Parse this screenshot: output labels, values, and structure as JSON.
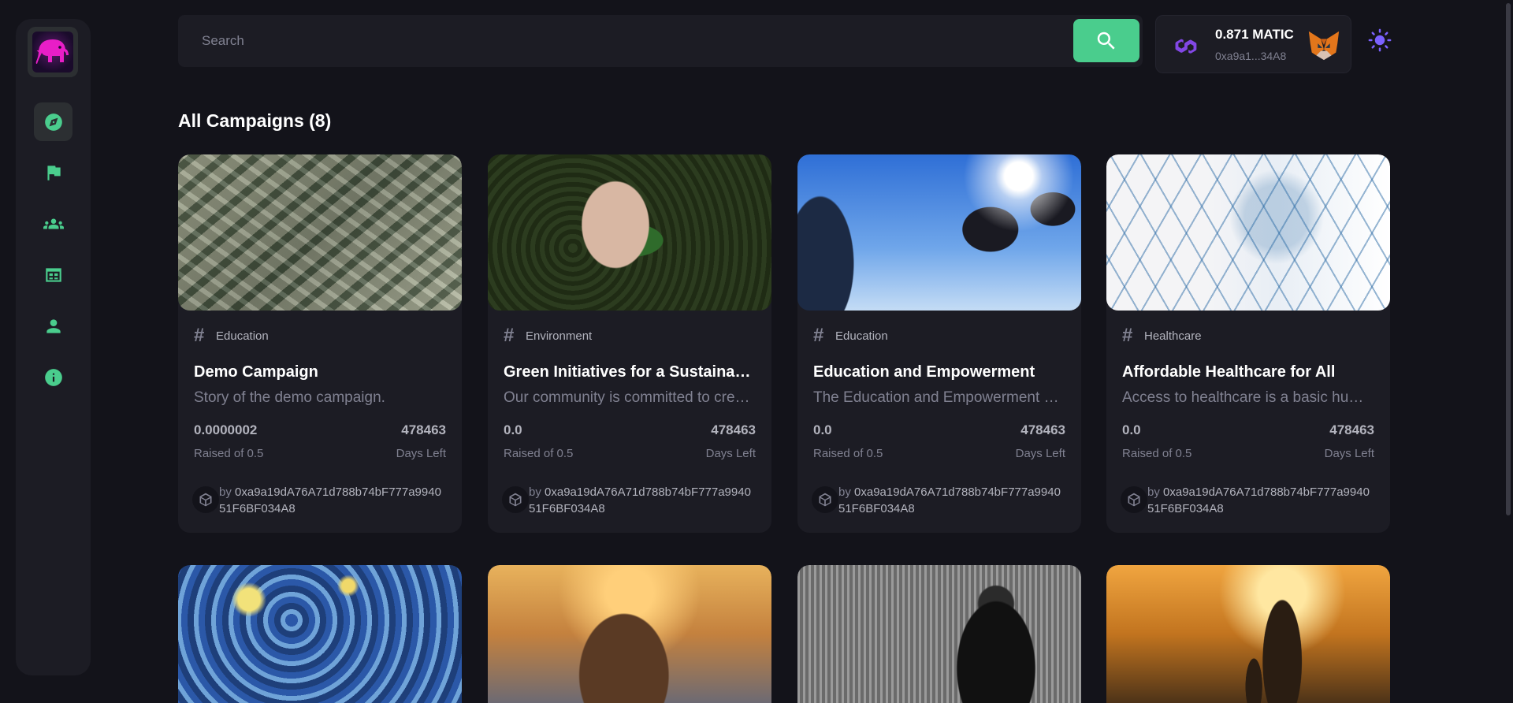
{
  "sidebar": {
    "logo": "elephant-logo",
    "items": [
      {
        "name": "dashboard",
        "icon": "compass-icon",
        "active": true
      },
      {
        "name": "campaign",
        "icon": "flag-icon",
        "active": false
      },
      {
        "name": "community",
        "icon": "group-icon",
        "active": false
      },
      {
        "name": "payment",
        "icon": "calendar-table-icon",
        "active": false
      },
      {
        "name": "profile",
        "icon": "person-icon",
        "active": false
      },
      {
        "name": "info",
        "icon": "info-icon",
        "active": false
      }
    ]
  },
  "search": {
    "placeholder": "Search",
    "button_icon": "search-icon"
  },
  "wallet": {
    "amount": "0.871 MATIC",
    "address": "0xa9a1...34A8",
    "network_icon": "polygon-icon",
    "provider_icon": "metamask-fox-icon"
  },
  "theme_toggle": {
    "icon": "sun-icon"
  },
  "page": {
    "title": "All Campaigns (8)"
  },
  "colors": {
    "accent": "#4acd8d",
    "background": "#13131a",
    "card": "#1c1c24",
    "muted": "#808191",
    "light": "#b2b3bd"
  },
  "campaigns": [
    {
      "category": "Education",
      "title": "Demo Campaign",
      "description": "Story of the demo campaign.",
      "raised": "0.0000002",
      "raised_label": "Raised of 0.5",
      "days": "478463",
      "days_label": "Days Left",
      "owner_prefix": "by ",
      "owner": "0xa9a19dA76A71d788b74bF777a994051F6BF034A8",
      "image": "money"
    },
    {
      "category": "Environment",
      "title": "Green Initiatives for a Sustainable Future",
      "description": "Our community is committed to creating a greener world",
      "raised": "0.0",
      "raised_label": "Raised of 0.5",
      "days": "478463",
      "days_label": "Days Left",
      "owner_prefix": "by ",
      "owner": "0xa9a19dA76A71d788b74bF777a994051F6BF034A8",
      "image": "plant"
    },
    {
      "category": "Education",
      "title": "Education and Empowerment",
      "description": "The Education and Empowerment campaign",
      "raised": "0.0",
      "raised_label": "Raised of 0.5",
      "days": "478463",
      "days_label": "Days Left",
      "owner_prefix": "by ",
      "owner": "0xa9a19dA76A71d788b74bF777a994051F6BF034A8",
      "image": "graduation"
    },
    {
      "category": "Healthcare",
      "title": "Affordable Healthcare for All",
      "description": "Access to healthcare is a basic human right",
      "raised": "0.0",
      "raised_label": "Raised of 0.5",
      "days": "478463",
      "days_label": "Days Left",
      "owner_prefix": "by ",
      "owner": "0xa9a19dA76A71d788b74bF777a994051F6BF034A8",
      "image": "health"
    },
    {
      "image": "starry-night"
    },
    {
      "image": "deer"
    },
    {
      "image": "mlk"
    },
    {
      "image": "sunset-walk"
    }
  ]
}
